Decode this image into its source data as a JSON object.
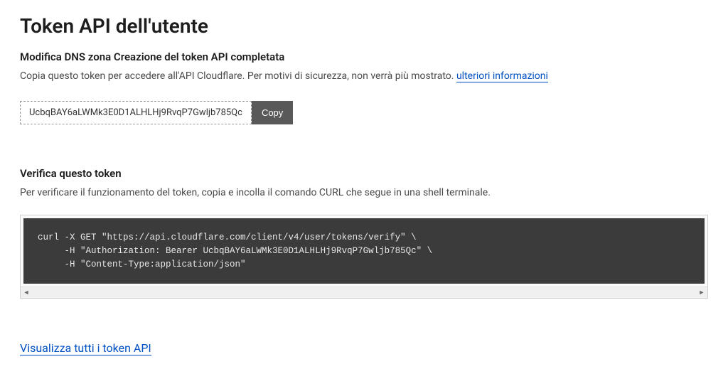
{
  "page": {
    "title": "Token API dell'utente"
  },
  "created": {
    "heading": "Modifica DNS zona Creazione del token API completata",
    "description_prefix": "Copia questo token per accedere all'API Cloudflare. Per motivi di sicurezza, non verrà più mostrato. ",
    "more_info_link": "ulteriori informazioni"
  },
  "token": {
    "value": "UcbqBAY6aLWMk3E0D1ALHLHj9RvqP7Gwljb785Qc",
    "copy_label": "Copy"
  },
  "verify": {
    "heading": "Verifica questo token",
    "description": "Per verificare il funzionamento del token, copia e incolla il comando CURL che segue in una shell terminale.",
    "curl_command": "curl -X GET \"https://api.cloudflare.com/client/v4/user/tokens/verify\" \\\n     -H \"Authorization: Bearer UcbqBAY6aLWMk3E0D1ALHLHj9RvqP7Gwljb785Qc\" \\\n     -H \"Content-Type:application/json\""
  },
  "footer": {
    "view_all_link": "Visualizza tutti i token API"
  }
}
